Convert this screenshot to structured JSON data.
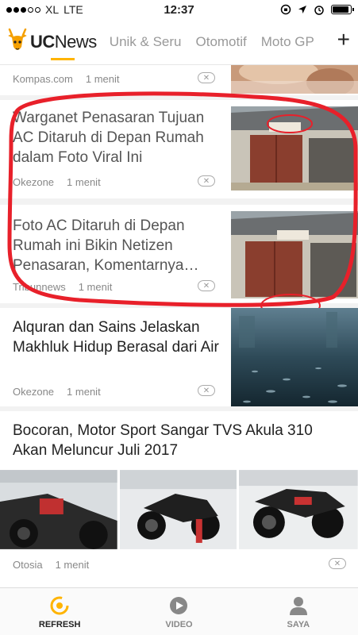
{
  "status": {
    "carrier": "XL",
    "network": "LTE",
    "time": "12:37"
  },
  "header": {
    "logo_uc": "UC",
    "logo_news": "News",
    "tabs": [
      "Unik & Seru",
      "Otomotif",
      "Moto GP"
    ],
    "add_icon": "plus-icon"
  },
  "articles": [
    {
      "title": "",
      "source": "Kompas.com",
      "time": "1 menit"
    },
    {
      "title": "Warganet Penasaran Tujuan AC Ditaruh di Depan Rumah dalam Foto Viral Ini",
      "source": "Okezone",
      "time": "1 menit"
    },
    {
      "title": "Foto AC Ditaruh di Depan Rumah ini Bikin Netizen Penasaran, Komentarnya…",
      "source": "Tribunnews",
      "time": "1 menit"
    },
    {
      "title": "Alquran dan Sains Jelaskan Makhluk Hidup Berasal dari Air",
      "source": "Okezone",
      "time": "1 menit"
    },
    {
      "title": "Bocoran, Motor Sport Sangar TVS Akula 310 Akan Meluncur Juli 2017",
      "source": "Otosia",
      "time": "1 menit"
    }
  ],
  "bottom_nav": [
    {
      "label": "REFRESH",
      "icon": "refresh-icon"
    },
    {
      "label": "VIDEO",
      "icon": "video-play-icon"
    },
    {
      "label": "SAYA",
      "icon": "user-icon"
    }
  ],
  "colors": {
    "accent": "#ffb400",
    "annotation": "#e8202a"
  }
}
